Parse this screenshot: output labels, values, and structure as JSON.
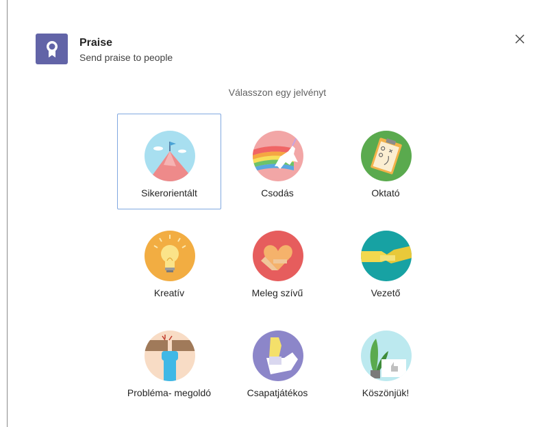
{
  "header": {
    "title": "Praise",
    "subtitle": "Send praise to people"
  },
  "prompt": "Válasszon egy jelvényt",
  "badges": [
    {
      "label": "Sikerorientált",
      "icon": "mountain-flag-icon",
      "selected": true
    },
    {
      "label": "Csodás",
      "icon": "unicorn-rainbow-icon"
    },
    {
      "label": "Oktató",
      "icon": "clipboard-strategy-icon"
    },
    {
      "label": "Kreatív",
      "icon": "lightbulb-icon"
    },
    {
      "label": "Meleg szívű",
      "icon": "heart-hands-icon"
    },
    {
      "label": "Vezető",
      "icon": "handshake-icon"
    },
    {
      "label": "Probléma- megoldó",
      "icon": "fist-breaking-icon"
    },
    {
      "label": "Csapatjátékos",
      "icon": "fist-bump-icon"
    },
    {
      "label": "Köszönjük!",
      "icon": "plant-thumbs-up-icon"
    }
  ],
  "colors": {
    "accent": "#6264a7",
    "selected_border": "#7fa7e0"
  }
}
